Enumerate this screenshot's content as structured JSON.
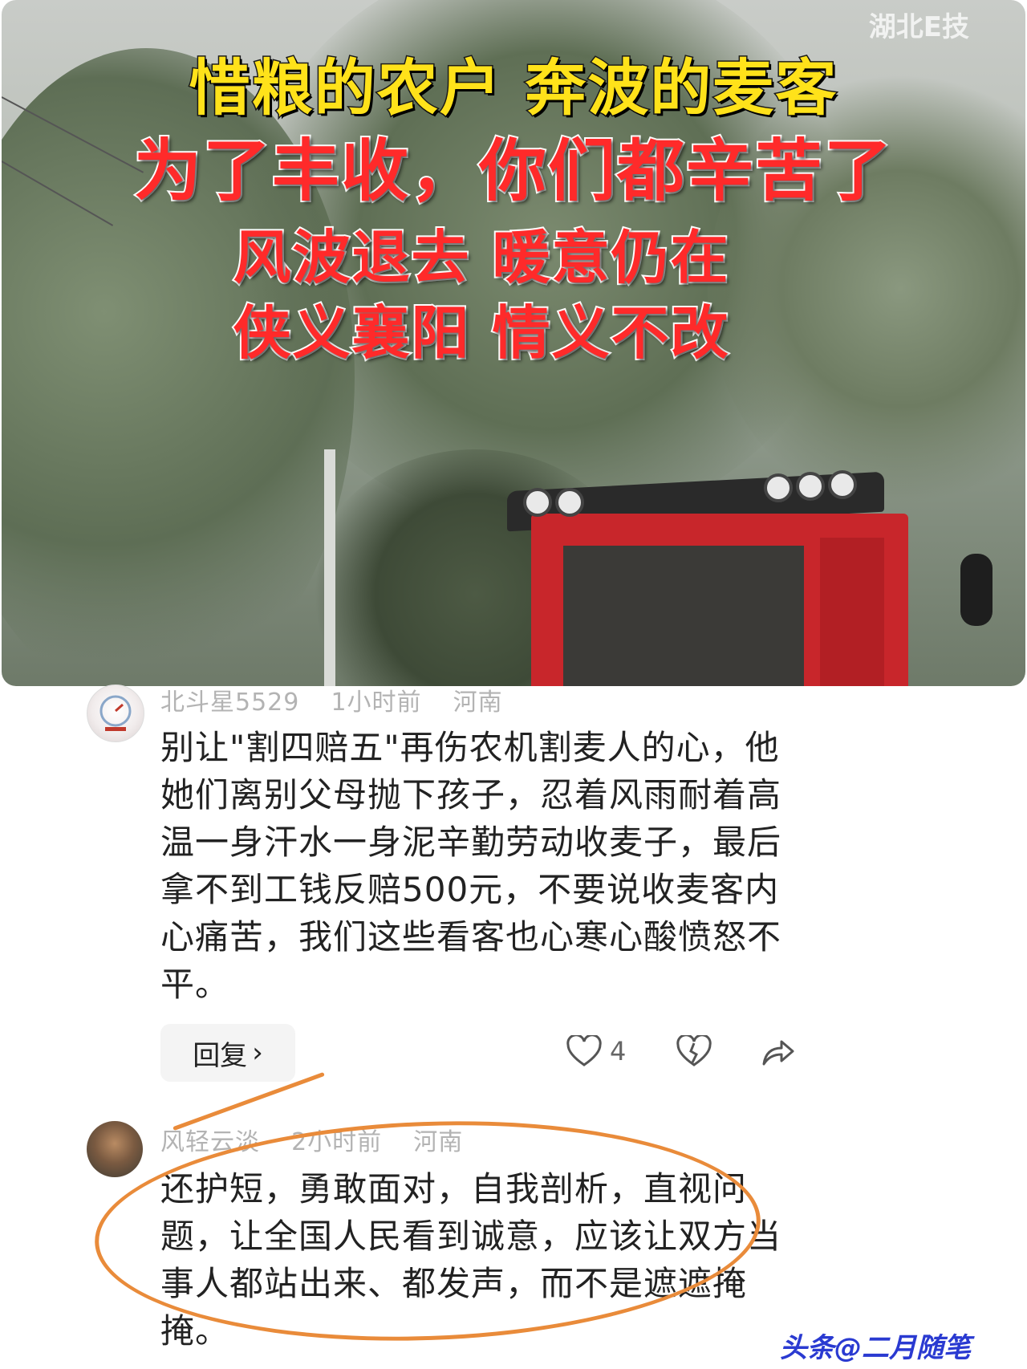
{
  "video": {
    "overlay_lines": [
      "惜粮的农户 奔波的麦客",
      "为了丰收，你们都辛苦了",
      "风波退去 暖意仍在",
      "侠义襄阳 情义不改"
    ],
    "corner_watermark": "湖北E技"
  },
  "comments": [
    {
      "username": "北斗星5529",
      "time": "1小时前",
      "location": "河南",
      "text": "别让\"割四赔五\"再伤农机割麦人的心，他她们离别父母抛下孩子，忍着风雨耐着高温一身汗水一身泥辛勤劳动收麦子，最后拿不到工钱反赔500元，不要说收麦客内心痛苦，我们这些看客也心寒心酸愤怒不平。",
      "reply_label": "回复",
      "like_count": "4"
    },
    {
      "username": "风轻云淡",
      "time": "2小时前",
      "location": "河南",
      "text": "还护短，勇敢面对，自我剖析，直视问题，让全国人民看到诚意，应该让双方当事人都站出来、都发声，而不是遮遮掩掩。"
    }
  ],
  "brand_watermark": "头条@二月随笔",
  "colors": {
    "overlay_yellow": "#ffe21a",
    "overlay_red": "#ff2a2a",
    "annotation_orange": "#e98b3a",
    "watermark_blue": "#2a3ad1"
  }
}
